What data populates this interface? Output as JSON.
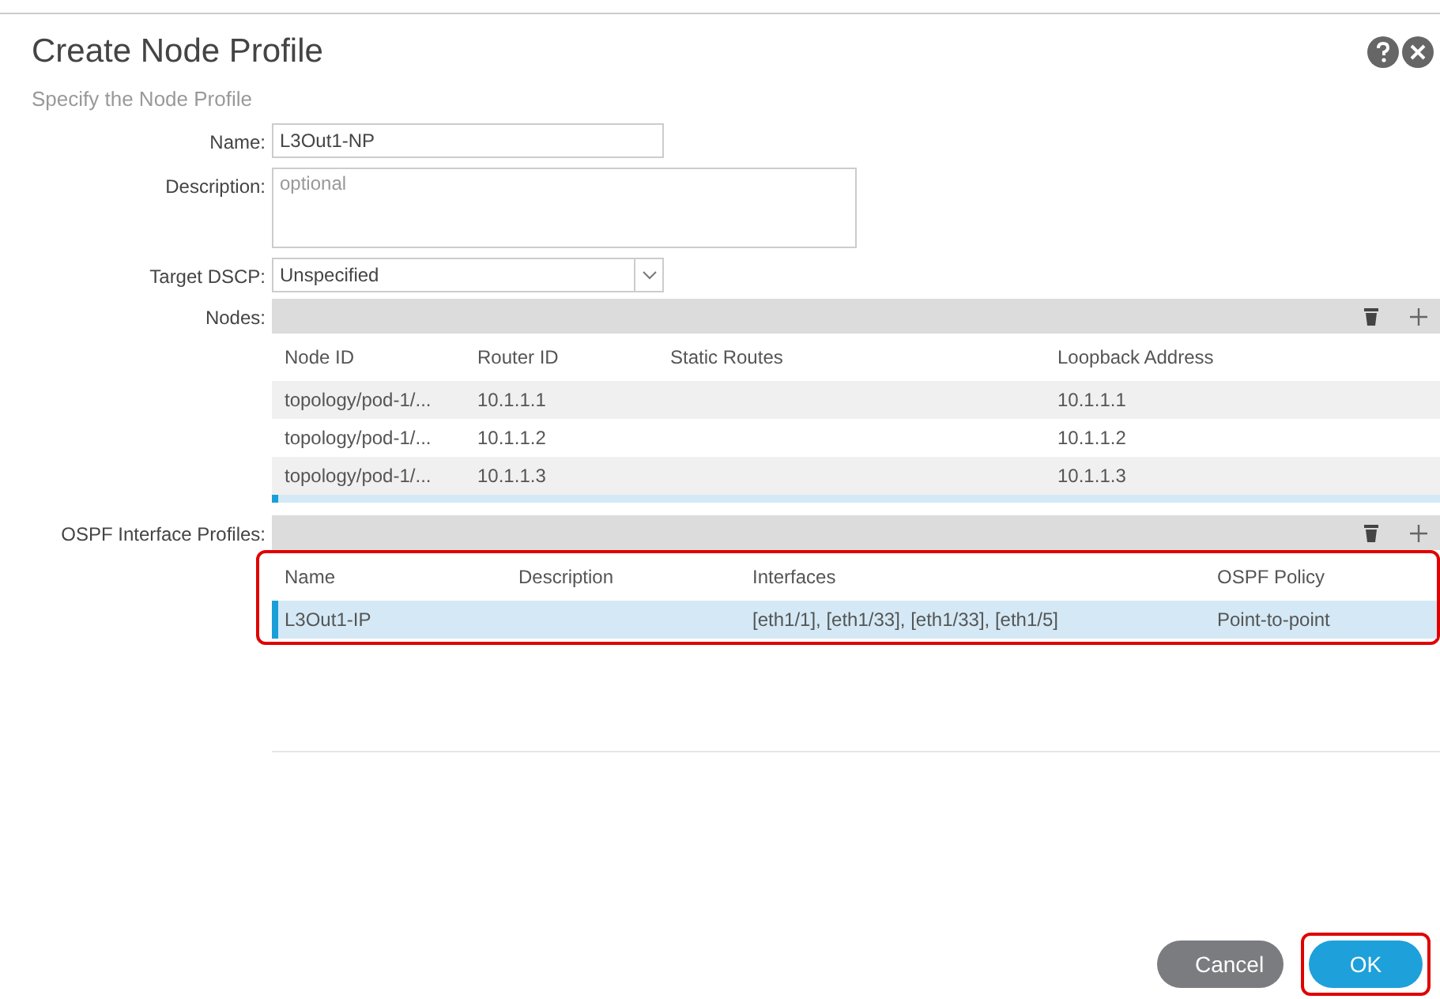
{
  "dialog": {
    "title": "Create Node Profile",
    "subtitle": "Specify the Node Profile"
  },
  "fields": [
    {
      "kind": "text",
      "label": "Name:",
      "value": "L3Out1-NP"
    },
    {
      "kind": "textarea",
      "label": "Description:",
      "placeholder": "optional"
    },
    {
      "kind": "select",
      "label": "Target DSCP:",
      "value": "Unspecified"
    }
  ],
  "nodes": {
    "label": "Nodes:",
    "columns": [
      "Node ID",
      "Router ID",
      "Static Routes",
      "Loopback Address"
    ],
    "rows": [
      {
        "selected": false,
        "cells": [
          "topology/pod-1/...",
          "10.1.1.1",
          "",
          "10.1.1.1"
        ]
      },
      {
        "selected": false,
        "cells": [
          "topology/pod-1/...",
          "10.1.1.2",
          "",
          "10.1.1.2"
        ]
      },
      {
        "selected": false,
        "cells": [
          "topology/pod-1/...",
          "10.1.1.3",
          "",
          "10.1.1.3"
        ]
      },
      {
        "selected": true
      }
    ]
  },
  "ospf_interface_profiles": {
    "label": "OSPF Interface Profiles:",
    "highlighted": true,
    "columns": [
      "Name",
      "Description",
      "Interfaces",
      "OSPF Policy"
    ],
    "rows": [
      {
        "selected": true,
        "cells": [
          "L3Out1-IP",
          "",
          "[eth1/1], [eth1/33], [eth1/33], [eth1/5]",
          "Point-to-point"
        ]
      }
    ]
  },
  "buttons": [
    {
      "kind": "secondary",
      "label": "Cancel",
      "highlighted": false
    },
    {
      "kind": "primary",
      "label": "OK",
      "highlighted": true
    }
  ]
}
